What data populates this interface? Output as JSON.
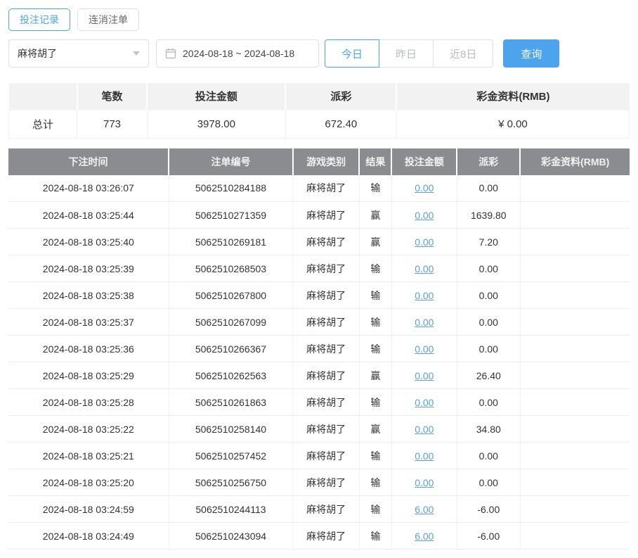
{
  "colors": {
    "accent": "#4da3ec",
    "link": "#579fe0",
    "negative": "#e05252",
    "table_header_bg": "#8b8c8f",
    "summary_header_bg": "#f2f2f2"
  },
  "tabs": [
    {
      "label": "投注记录",
      "active": true
    },
    {
      "label": "连消注单",
      "active": false
    }
  ],
  "filters": {
    "game_select": {
      "value": "麻将胡了"
    },
    "date_range": "2024-08-18 ~ 2024-08-18",
    "quick_buttons": [
      {
        "label": "今日",
        "active": true
      },
      {
        "label": "昨日",
        "active": false
      },
      {
        "label": "近8日",
        "active": false
      }
    ],
    "search_label": "查询"
  },
  "summary": {
    "headers": [
      "",
      "笔数",
      "投注金额",
      "派彩",
      "彩金资料(RMB)"
    ],
    "total": {
      "label": "总计",
      "count": "773",
      "bet_amount": "3978.00",
      "payout": "672.40",
      "bonus": "¥ 0.00"
    }
  },
  "table": {
    "headers": [
      "下注时间",
      "注单编号",
      "游戏类别",
      "结果",
      "投注金额",
      "派彩",
      "彩金资料(RMB)"
    ],
    "rows": [
      {
        "time": "2024-08-18 03:26:07",
        "order_id": "5062510284188",
        "game": "麻将胡了",
        "result": "输",
        "bet": "0.00",
        "payout": "0.00",
        "bonus": ""
      },
      {
        "time": "2024-08-18 03:25:44",
        "order_id": "5062510271359",
        "game": "麻将胡了",
        "result": "赢",
        "bet": "0.00",
        "payout": "1639.80",
        "bonus": ""
      },
      {
        "time": "2024-08-18 03:25:40",
        "order_id": "5062510269181",
        "game": "麻将胡了",
        "result": "赢",
        "bet": "0.00",
        "payout": "7.20",
        "bonus": ""
      },
      {
        "time": "2024-08-18 03:25:39",
        "order_id": "5062510268503",
        "game": "麻将胡了",
        "result": "输",
        "bet": "0.00",
        "payout": "0.00",
        "bonus": ""
      },
      {
        "time": "2024-08-18 03:25:38",
        "order_id": "5062510267800",
        "game": "麻将胡了",
        "result": "输",
        "bet": "0.00",
        "payout": "0.00",
        "bonus": ""
      },
      {
        "time": "2024-08-18 03:25:37",
        "order_id": "5062510267099",
        "game": "麻将胡了",
        "result": "输",
        "bet": "0.00",
        "payout": "0.00",
        "bonus": ""
      },
      {
        "time": "2024-08-18 03:25:36",
        "order_id": "5062510266367",
        "game": "麻将胡了",
        "result": "输",
        "bet": "0.00",
        "payout": "0.00",
        "bonus": ""
      },
      {
        "time": "2024-08-18 03:25:29",
        "order_id": "5062510262563",
        "game": "麻将胡了",
        "result": "赢",
        "bet": "0.00",
        "payout": "26.40",
        "bonus": ""
      },
      {
        "time": "2024-08-18 03:25:28",
        "order_id": "5062510261863",
        "game": "麻将胡了",
        "result": "输",
        "bet": "0.00",
        "payout": "0.00",
        "bonus": ""
      },
      {
        "time": "2024-08-18 03:25:22",
        "order_id": "5062510258140",
        "game": "麻将胡了",
        "result": "赢",
        "bet": "0.00",
        "payout": "34.80",
        "bonus": ""
      },
      {
        "time": "2024-08-18 03:25:21",
        "order_id": "5062510257452",
        "game": "麻将胡了",
        "result": "输",
        "bet": "0.00",
        "payout": "0.00",
        "bonus": ""
      },
      {
        "time": "2024-08-18 03:25:20",
        "order_id": "5062510256750",
        "game": "麻将胡了",
        "result": "输",
        "bet": "0.00",
        "payout": "0.00",
        "bonus": ""
      },
      {
        "time": "2024-08-18 03:24:59",
        "order_id": "5062510244113",
        "game": "麻将胡了",
        "result": "输",
        "bet": "6.00",
        "payout": "-6.00",
        "bonus": ""
      },
      {
        "time": "2024-08-18 03:24:49",
        "order_id": "5062510243094",
        "game": "麻将胡了",
        "result": "输",
        "bet": "6.00",
        "payout": "-6.00",
        "bonus": ""
      }
    ]
  }
}
